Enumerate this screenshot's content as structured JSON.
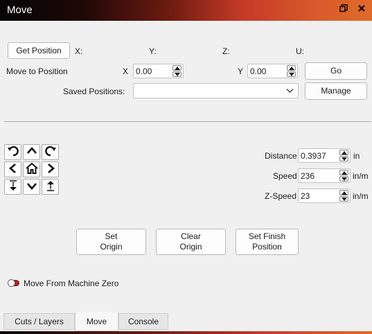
{
  "window": {
    "title": "Move",
    "restore_icon": "restore-icon",
    "close_icon": "close-icon"
  },
  "position": {
    "get_position_label": "Get Position",
    "x_label": "X:",
    "y_label": "Y:",
    "z_label": "Z:",
    "u_label": "U:"
  },
  "move_to": {
    "label": "Move to Position",
    "x_label": "X",
    "x_value": "0.00",
    "y_label": "Y",
    "y_value": "0.00",
    "go_label": "Go"
  },
  "saved": {
    "label": "Saved Positions:",
    "selected": "",
    "manage_label": "Manage"
  },
  "jog": {
    "icons": [
      "rotate-ccw-icon",
      "arrow-up-icon",
      "rotate-cw-icon",
      "arrow-left-icon",
      "home-icon",
      "arrow-right-icon",
      "z-down-icon",
      "arrow-down-icon",
      "z-up-icon"
    ]
  },
  "settings": {
    "distance_label": "Distance",
    "distance_value": "0.3937",
    "distance_unit": "in",
    "speed_label": "Speed",
    "speed_value": "236",
    "speed_unit": "in/m",
    "zspeed_label": "Z-Speed",
    "zspeed_value": "23",
    "zspeed_unit": "in/m"
  },
  "origin_buttons": {
    "set_origin_line1": "Set",
    "set_origin_line2": "Origin",
    "clear_origin_line1": "Clear",
    "clear_origin_line2": "Origin",
    "set_finish_line1": "Set Finish",
    "set_finish_line2": "Position"
  },
  "machine_zero": {
    "label": "Move From Machine Zero",
    "enabled": false
  },
  "tabs": [
    {
      "label": "Cuts / Layers",
      "active": false
    },
    {
      "label": "Move",
      "active": true
    },
    {
      "label": "Console",
      "active": false
    }
  ],
  "colors": {
    "title_gradient_start": "#050505",
    "title_gradient_end": "#e06a2a",
    "toggle_off": "#b22222"
  }
}
